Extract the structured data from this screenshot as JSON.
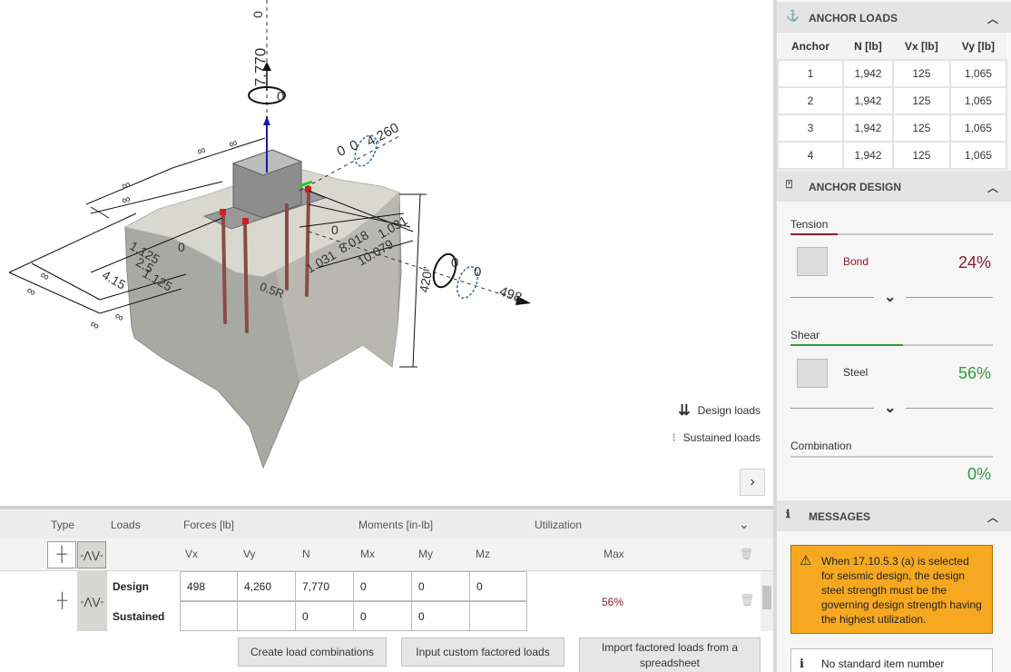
{
  "viewport": {
    "dims": {
      "top_vertical": "7,770",
      "top_tip": "0",
      "top_moment": "0",
      "mx_value": "4,260",
      "mx_a": "0",
      "mx_b": "0",
      "vx_arrow": "498",
      "vx_moment_a": "0",
      "vx_moment_b": "0",
      "depth": "420\"",
      "radius": "0.5R",
      "left_1": "1.125",
      "left_2": "4.15",
      "left_3": "1.125",
      "left_4": "2.5",
      "left_zero": "0",
      "right_1": "1.031",
      "right_2": "8.018",
      "right_3": "1.031",
      "right_4": "10.079",
      "right_zero": "0",
      "inf": "∞"
    },
    "legend": {
      "design": "Design loads",
      "sustained": "Sustained loads"
    }
  },
  "loads": {
    "header": {
      "type": "Type",
      "loads": "Loads",
      "forces": "Forces [lb]",
      "moments": "Moments [in-lb]",
      "utilization": "Utilization"
    },
    "columns": [
      "Vx",
      "Vy",
      "N",
      "Mx",
      "My",
      "Mz",
      "Max"
    ],
    "rows": [
      {
        "label": "Design",
        "vx": "498",
        "vy": "4,260",
        "n": "7,770",
        "mx": "0",
        "my": "0",
        "mz": "0"
      },
      {
        "label": "Sustained",
        "vx": "",
        "vy": "",
        "n": "0",
        "mx": "0",
        "my": "0",
        "mz": ""
      }
    ],
    "utilization_value": "56%",
    "buttons": {
      "create": "Create load combinations",
      "custom": "Input custom factored loads",
      "import": "Import factored loads from a spreadsheet"
    }
  },
  "sidebar": {
    "anchor_loads": {
      "title": "ANCHOR LOADS",
      "columns": [
        "Anchor",
        "N [lb]",
        "Vx [lb]",
        "Vy [lb]"
      ],
      "rows": [
        {
          "anchor": "1",
          "n": "1,942",
          "vx": "125",
          "vy": "1,065"
        },
        {
          "anchor": "2",
          "n": "1,942",
          "vx": "125",
          "vy": "1,065"
        },
        {
          "anchor": "3",
          "n": "1,942",
          "vx": "125",
          "vy": "1,065"
        },
        {
          "anchor": "4",
          "n": "1,942",
          "vx": "125",
          "vy": "1,065"
        }
      ]
    },
    "anchor_design": {
      "title": "ANCHOR DESIGN",
      "tension": {
        "label": "Tension",
        "item": "Bond",
        "value": "24%",
        "color": "#8b1a2b"
      },
      "shear": {
        "label": "Shear",
        "item": "Steel",
        "value": "56%",
        "color": "#2e9a3e"
      },
      "combination": {
        "label": "Combination",
        "value": "0%",
        "color": "#2e9a3e"
      }
    },
    "messages": {
      "title": "MESSAGES",
      "warning": "When 17.10.5.3 (a) is selected for seismic design, the design steel strength must be the governing design strength having the highest utilization.",
      "info": "No standard item number"
    }
  }
}
